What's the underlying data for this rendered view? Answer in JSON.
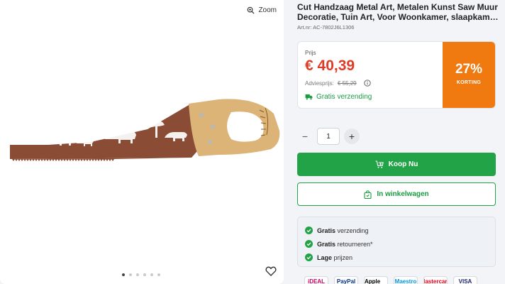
{
  "gallery": {
    "zoom_label": "Zoom",
    "dot_count": 6,
    "active_index": 0
  },
  "product": {
    "title_line1": "Cut Handzaag Metal Art, Metalen Kunst Saw Muur",
    "title_line2": "Decoratie, Tuin Art, Voor Woonkamer, slaapkame...",
    "artnr": "Art.nr: AC-7802J6L1306"
  },
  "pricing": {
    "label": "Prijs",
    "price": "€ 40,39",
    "advies_label": "Adviesprijs:",
    "advies_price": "€ 55,29",
    "shipping": "Gratis verzending",
    "discount_pct": "27%",
    "discount_label": "KORTING"
  },
  "quantity": {
    "minus": "−",
    "value": "1",
    "plus": "+"
  },
  "actions": {
    "buy_now": "Koop Nu",
    "add_to_cart": "In winkelwagen"
  },
  "usps": [
    {
      "bold": "Gratis",
      "rest": " verzending"
    },
    {
      "bold": "Gratis",
      "rest": " retourneren*"
    },
    {
      "bold": "Lage",
      "rest": " prijzen"
    }
  ],
  "payment_methods": [
    {
      "name": "iDEAL",
      "icon": "ideal-icon",
      "color": "#cc0066"
    },
    {
      "name": "PayPal",
      "icon": "paypal-icon",
      "color": "#003087"
    },
    {
      "name": "Apple Pay",
      "icon": "apple-pay-icon",
      "color": "#000000"
    },
    {
      "name": "Maestro",
      "icon": "maestro-icon",
      "color": "#0099df"
    },
    {
      "name": "Mastercard",
      "icon": "mastercard-icon",
      "color": "#eb001b"
    },
    {
      "name": "VISA",
      "icon": "visa-icon",
      "color": "#1a1f71"
    }
  ],
  "colors": {
    "accent_green": "#22a348",
    "price_red": "#e03b24",
    "discount_orange": "#f07a10"
  }
}
